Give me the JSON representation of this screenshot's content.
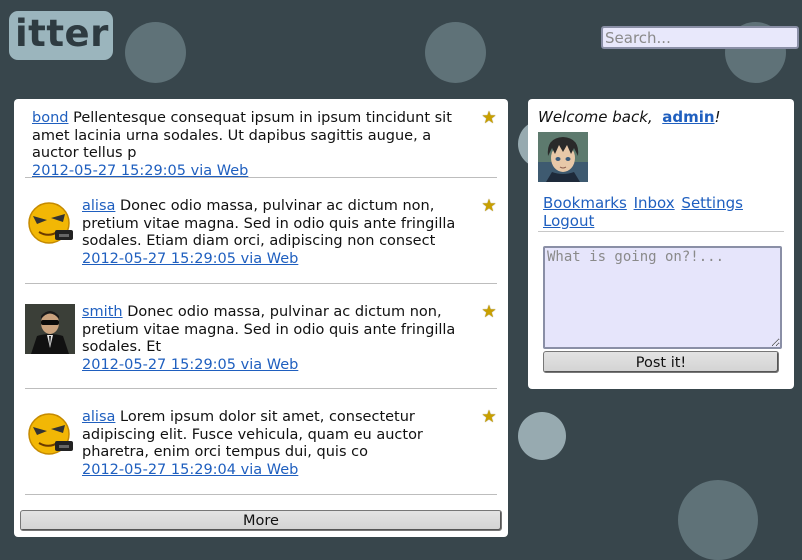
{
  "app": {
    "logo_text": "itter"
  },
  "search": {
    "placeholder": "Search..."
  },
  "timeline": {
    "tweets": [
      {
        "user": "bond",
        "text": "Pellentesque consequat ipsum in ipsum tincidunt sit amet lacinia urna sodales. Ut dapibus sagittis augue, a auctor tellus p",
        "meta": "2012-05-27 15:29:05 via Web",
        "avatar": "none"
      },
      {
        "user": "alisa",
        "text": "Donec odio massa, pulvinar ac dictum non, pretium vitae magna. Sed in odio quis ante fringilla sodales. Etiam diam orci, adipiscing non consect",
        "meta": "2012-05-27 15:29:05 via Web",
        "avatar": "yellow-smiley-avatar"
      },
      {
        "user": "smith",
        "text": "Donec odio massa, pulvinar ac dictum non, pretium vitae magna. Sed in odio quis ante fringilla sodales. Et",
        "meta": "2012-05-27 15:29:05 via Web",
        "avatar": "man-in-suit-avatar"
      },
      {
        "user": "alisa",
        "text": "Lorem ipsum dolor sit amet, consectetur adipiscing elit. Fusce vehicula, quam eu auctor pharetra, enim orci tempus dui, quis co",
        "meta": "2012-05-27 15:29:04 via Web",
        "avatar": "yellow-smiley-avatar"
      }
    ],
    "more_label": "More"
  },
  "sidebar": {
    "welcome_prefix": "Welcome back,",
    "username": "admin",
    "welcome_suffix": "!",
    "links": {
      "bookmarks": "Bookmarks",
      "inbox": "Inbox",
      "settings": "Settings",
      "logout": "Logout"
    },
    "status_placeholder": "What is going on?!...",
    "post_label": "Post it!"
  },
  "colors": {
    "background": "#38464c",
    "link": "#1f5fbf",
    "star": "#c9a000"
  }
}
